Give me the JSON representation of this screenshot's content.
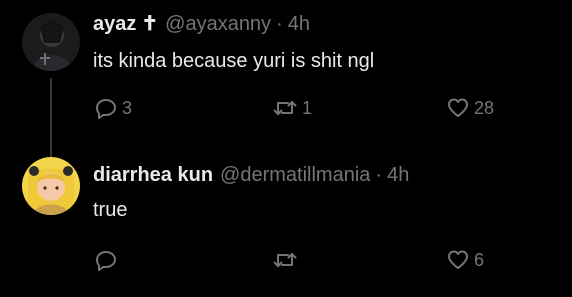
{
  "tweets": [
    {
      "name": "ayaz",
      "badge": "✝",
      "handle": "@ayaxanny",
      "separator": "·",
      "time": "4h",
      "text": "its kinda because yuri is shit ngl",
      "reply_count": "3",
      "retweet_count": "1",
      "like_count": "28",
      "avatar_colors": [
        "#1b1b1d",
        "#3a3a3e",
        "#6e6e74"
      ]
    },
    {
      "name": "diarrhea kun",
      "handle": "@dermatillmania",
      "separator": "·",
      "time": "4h",
      "text": "true",
      "reply_count": "",
      "retweet_count": "",
      "like_count": "6",
      "avatar_colors": [
        "#f2d54a",
        "#f4c9a8",
        "#c9a24a"
      ]
    }
  ],
  "theme": {
    "background": "#000000",
    "primary_text": "#e7e9ea",
    "secondary_text": "#71767b",
    "thread_line": "#333639"
  }
}
